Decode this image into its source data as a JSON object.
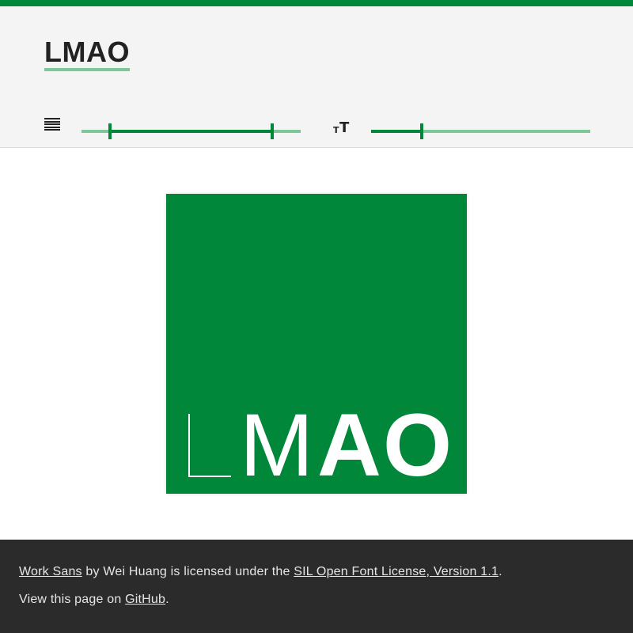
{
  "header": {
    "title": "LMAO",
    "weight_control_icon": "lines-icon",
    "size_control_icon": "font-size-icon",
    "weight_range": {
      "min_value": 0.13,
      "max_value": 0.87
    },
    "font_size": {
      "value": 0.23
    }
  },
  "preview": {
    "glyphs": [
      "L",
      "M",
      "A",
      "O"
    ]
  },
  "footer": {
    "font_link": "Work Sans",
    "by_text": " by Wei Huang is licensed under the ",
    "license_link": "SIL Open Font License, Version 1.1",
    "period1": ".",
    "view_text": "View this page on ",
    "github_link": "GitHub",
    "period2": "."
  },
  "colors": {
    "accent": "#00873a",
    "accent_light": "#7cc79a",
    "header_bg": "#f4f4f4",
    "footer_bg": "#2b2b2b"
  }
}
